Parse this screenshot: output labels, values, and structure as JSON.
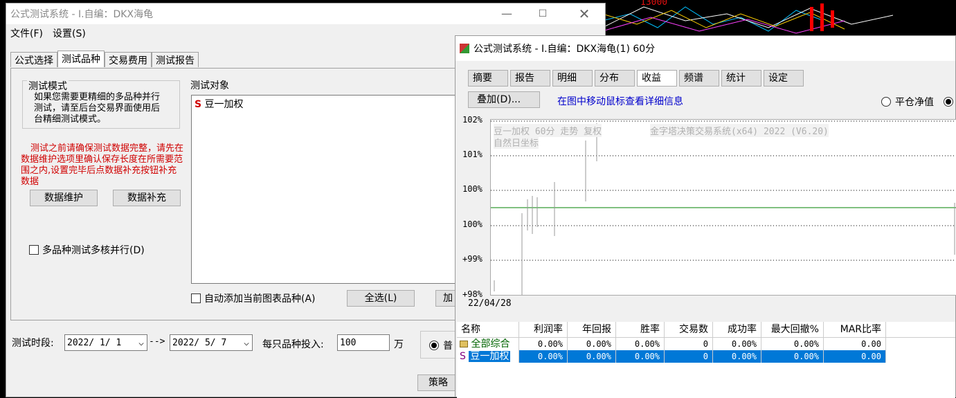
{
  "bg": {
    "label": "13000"
  },
  "w1": {
    "title": "公式测试系统 - I.自编：DKX海龟",
    "menu": [
      "文件(F)",
      "设置(S)"
    ],
    "tabs": [
      "公式选择",
      "测试品种",
      "交易费用",
      "测试报告"
    ],
    "mode_title": "测试模式",
    "mode_text": "如果您需要更精细的多品种并行测试，请至后台交易界面使用后台精细测试模式。",
    "warning": "测试之前请确保测试数据完整，请先在数据维护选项里确认保存长度在所需要范围之内,设置完毕后点数据补充按钮补充数据",
    "btn_maintain": "数据维护",
    "btn_supplement": "数据补充",
    "multi_core": "多品种测试多核并行(D)",
    "target_title": "测试对象",
    "target_item_tag": "S",
    "target_item": "豆一加权",
    "auto_add": "自动添加当前图表品种(A)",
    "select_all": "全选(L)",
    "add_btn": "加",
    "period_label": "测试时段:",
    "date_from": "2022/ 1/ 1",
    "arrow": "-->",
    "date_to": "2022/ 5/ 7",
    "invest_label": "每只品种投入:",
    "invest_value": "100",
    "invest_unit": "万",
    "radio_label": "普",
    "strategy_btn": "策略"
  },
  "w2": {
    "title": "公式测试系统 - I.自编：DKX海龟(1) 60分",
    "tabs": [
      "摘要",
      "报告",
      "明细",
      "分布",
      "收益",
      "频谱",
      "统计",
      "设定"
    ],
    "selected_tab": "收益",
    "overlay_btn": "叠加(D)...",
    "hint": "在图中移动鼠标查看详细信息",
    "radio_close": "平仓净值",
    "chart_info1": "豆一加权 60分 走势 复权",
    "chart_info2": "金字塔决策交易系统(x64) 2022 (V6.20)",
    "chart_info3": "自然日坐标",
    "date_label": "22/04/28",
    "table_headers": [
      "名称",
      "利润率",
      "年回报",
      "胜率",
      "交易数",
      "成功率",
      "最大回撤%",
      "MAR比率"
    ],
    "rows": [
      {
        "name": "全部综合",
        "tag": "",
        "cells": [
          "0.00%",
          "0.00%",
          "0.00%",
          "0",
          "0.00%",
          "0.00%",
          "0.00"
        ]
      },
      {
        "name": "豆一加权",
        "tag": "S",
        "cells": [
          "0.00%",
          "0.00%",
          "0.00%",
          "0",
          "0.00%",
          "0.00%",
          "0.00"
        ]
      }
    ]
  },
  "chart_data": {
    "type": "line",
    "yticks": [
      "102%",
      "101%",
      "100%",
      "100%",
      "+99%",
      "+98%"
    ],
    "x": [
      "22/04/28"
    ]
  }
}
